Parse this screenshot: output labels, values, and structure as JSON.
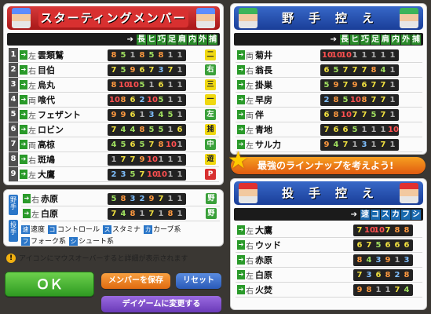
{
  "starting": {
    "title": "スターティングメンバー",
    "headers": [
      "長",
      "ヒ",
      "巧",
      "足",
      "肩",
      "内",
      "外",
      "捕"
    ],
    "rows": [
      {
        "num": "1",
        "side": "左",
        "name": "雲類鷲",
        "stats": [
          "8",
          "5",
          "1",
          "8",
          "5",
          "8",
          "1",
          "1"
        ],
        "pos": "二"
      },
      {
        "num": "2",
        "side": "右",
        "name": "目伯",
        "stats": [
          "7",
          "5",
          "9",
          "6",
          "7",
          "3",
          "7",
          "1"
        ],
        "pos": "右"
      },
      {
        "num": "3",
        "side": "左",
        "name": "烏丸",
        "stats": [
          "8",
          "10",
          "10",
          "5",
          "1",
          "6",
          "1",
          "1"
        ],
        "pos": "三"
      },
      {
        "num": "4",
        "side": "両",
        "name": "喰代",
        "stats": [
          "10",
          "8",
          "6",
          "2",
          "10",
          "5",
          "1",
          "1"
        ],
        "pos": "一"
      },
      {
        "num": "5",
        "side": "左",
        "name": "フェザント",
        "stats": [
          "9",
          "9",
          "6",
          "1",
          "3",
          "4",
          "5",
          "1"
        ],
        "pos": "左"
      },
      {
        "num": "6",
        "side": "左",
        "name": "ロビン",
        "stats": [
          "7",
          "4",
          "4",
          "8",
          "5",
          "5",
          "1",
          "6"
        ],
        "pos": "捕"
      },
      {
        "num": "7",
        "side": "両",
        "name": "高椋",
        "stats": [
          "4",
          "5",
          "6",
          "5",
          "7",
          "8",
          "10",
          "1"
        ],
        "pos": "中"
      },
      {
        "num": "8",
        "side": "右",
        "name": "斑鳩",
        "stats": [
          "1",
          "7",
          "7",
          "9",
          "10",
          "1",
          "1",
          "1"
        ],
        "pos": "遊"
      },
      {
        "num": "9",
        "side": "左",
        "name": "大鷹",
        "stats": [
          "2",
          "3",
          "5",
          "7",
          "10",
          "10",
          "1",
          "1"
        ],
        "pos": "P"
      }
    ]
  },
  "bench": {
    "tag_fielder": "野手",
    "tag_pitcher": "投手",
    "rows": [
      {
        "side": "右",
        "name": "赤原",
        "stats": [
          "5",
          "8",
          "3",
          "2",
          "9",
          "7",
          "1",
          "1"
        ],
        "pos": "野"
      },
      {
        "side": "左",
        "name": "白原",
        "stats": [
          "7",
          "4",
          "8",
          "1",
          "7",
          "1",
          "8",
          "1"
        ],
        "pos": "野"
      }
    ]
  },
  "legend": {
    "line1": [
      {
        "k": "速",
        "t": "速度"
      },
      {
        "k": "コ",
        "t": "コントロール"
      },
      {
        "k": "ス",
        "t": "スタミナ"
      },
      {
        "k": "カ",
        "t": "カーブ系"
      }
    ],
    "line2": [
      {
        "k": "フ",
        "t": "フォーク系"
      },
      {
        "k": "シ",
        "t": "シュート系"
      }
    ]
  },
  "note": "アイコンにマウスオーバーすると詳細が表示されます",
  "buttons": {
    "ok": "ＯＫ",
    "save": "メンバーを保存",
    "reset": "リセット",
    "dayGame": "デイゲームに変更する"
  },
  "fielders": {
    "title": "野　手　控　え",
    "headers": [
      "長",
      "ヒ",
      "巧",
      "足",
      "肩",
      "内",
      "外",
      "捕"
    ],
    "rows": [
      {
        "side": "両",
        "name": "菊井",
        "stats": [
          "10",
          "10",
          "10",
          "1",
          "1",
          "1",
          "1",
          "1"
        ]
      },
      {
        "side": "右",
        "name": "翁長",
        "stats": [
          "6",
          "5",
          "7",
          "7",
          "7",
          "8",
          "4",
          "1"
        ]
      },
      {
        "side": "左",
        "name": "掛巣",
        "stats": [
          "5",
          "9",
          "7",
          "9",
          "6",
          "7",
          "7",
          "1"
        ]
      },
      {
        "side": "左",
        "name": "早房",
        "stats": [
          "2",
          "8",
          "5",
          "10",
          "8",
          "7",
          "7",
          "1"
        ]
      },
      {
        "side": "両",
        "name": "伴",
        "stats": [
          "6",
          "8",
          "10",
          "7",
          "7",
          "5",
          "7",
          "1"
        ]
      },
      {
        "side": "左",
        "name": "青地",
        "stats": [
          "7",
          "6",
          "6",
          "5",
          "1",
          "1",
          "1",
          "10"
        ]
      },
      {
        "side": "左",
        "name": "サル力",
        "stats": [
          "9",
          "4",
          "7",
          "1",
          "3",
          "1",
          "7",
          "1"
        ]
      }
    ]
  },
  "promo": "最強のラインナップを考えよう!",
  "pitchers": {
    "title": "投　手　控　え",
    "headers": [
      "速",
      "コ",
      "ス",
      "カ",
      "フ",
      "シ"
    ],
    "rows": [
      {
        "side": "左",
        "name": "大鷹",
        "stats": [
          "7",
          "10",
          "10",
          "7",
          "8",
          "8"
        ]
      },
      {
        "side": "右",
        "name": "ウッド",
        "stats": [
          "6",
          "7",
          "5",
          "6",
          "6",
          "6"
        ]
      },
      {
        "side": "右",
        "name": "赤原",
        "stats": [
          "8",
          "4",
          "3",
          "9",
          "1",
          "3"
        ]
      },
      {
        "side": "左",
        "name": "白原",
        "stats": [
          "7",
          "3",
          "6",
          "8",
          "2",
          "8"
        ]
      },
      {
        "side": "右",
        "name": "火焚",
        "stats": [
          "9",
          "8",
          "1",
          "1",
          "7",
          "4"
        ]
      }
    ]
  }
}
